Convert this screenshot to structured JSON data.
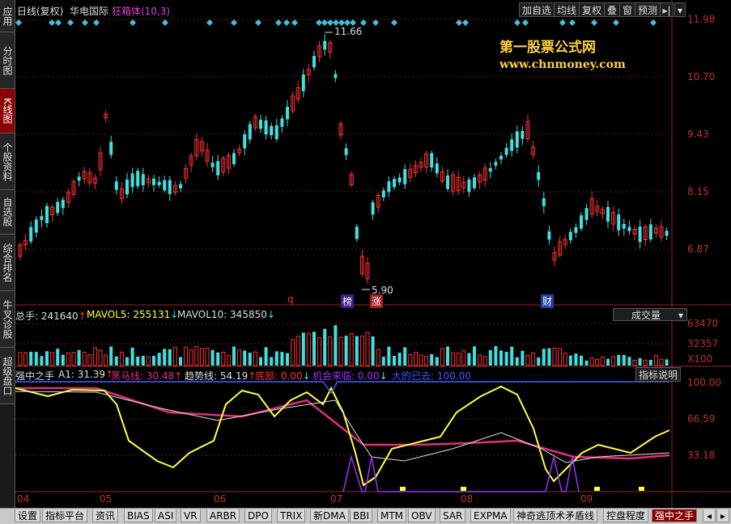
{
  "sidebar": {
    "tabs": [
      {
        "label": "应用"
      },
      {
        "label": "分时图"
      },
      {
        "label": "K线图",
        "active": true
      },
      {
        "label": "个股资料"
      },
      {
        "label": "自选股"
      },
      {
        "label": "综合排名"
      },
      {
        "label": "牛叉诊股"
      },
      {
        "label": "超级盘口"
      }
    ]
  },
  "header": {
    "mode": "日线(复权)",
    "stock_name": "华电国际",
    "indicator": "狂箱体(10,3)"
  },
  "toolbar": {
    "add_watch": "加自选",
    "ma": "均线",
    "restore": "复权",
    "overlay": "叠",
    "window": "窗",
    "forecast": "预测"
  },
  "watermark": {
    "line1": "第一股票公式网",
    "line2": "www.chnmoney.com"
  },
  "price_axis": [
    "11.98",
    "10.70",
    "9.43",
    "8.15",
    "6.87"
  ],
  "price_annotations": {
    "high": "11.66",
    "low": "5.90"
  },
  "event_markers": [
    "q",
    "榜",
    "涨",
    "财"
  ],
  "volume_panel": {
    "total": "总手: 241640",
    "mavol5": "MAVOL5: 255131",
    "mavol10": "MAVOL10: 345850",
    "dropdown": "成交量",
    "axis": [
      "63470",
      "32357",
      "X100"
    ]
  },
  "indicator_panel": {
    "name": "强中之手",
    "a1": "A1: 31.39",
    "heima": "黑马线: 30.48",
    "trend": "趋势线: 54.19",
    "bottom": "底部: 0.00",
    "chance": "机会来临: 0.00",
    "wave": "大的已去: 100.00",
    "help_button": "指标说明",
    "axis": [
      "100.00",
      "66.59",
      "33.18"
    ]
  },
  "date_axis": [
    "04",
    "05",
    "06",
    "07",
    "08",
    "09"
  ],
  "bottom_tabs": [
    {
      "label": "设置"
    },
    {
      "label": "指标平台"
    },
    {
      "label": "资讯"
    },
    {
      "label": "BIAS"
    },
    {
      "label": "ASI"
    },
    {
      "label": "VR"
    },
    {
      "label": "ARBR"
    },
    {
      "label": "DPO"
    },
    {
      "label": "TRIX"
    },
    {
      "label": "新DMA"
    },
    {
      "label": "BBI"
    },
    {
      "label": "MTM"
    },
    {
      "label": "OBV"
    },
    {
      "label": "SAR"
    },
    {
      "label": "EXPMA"
    },
    {
      "label": "神奇逃顶术矛盾线"
    },
    {
      "label": "控盘程度"
    },
    {
      "label": "强中之手",
      "active": true
    }
  ],
  "colors": {
    "up": "#ff3030",
    "down": "#40e0e0",
    "axis_red": "#c03030",
    "yellow": "#ffff40",
    "magenta": "#e0307a",
    "blue": "#3060ff",
    "violet": "#a030ff",
    "watermark": "#ffd040"
  }
}
